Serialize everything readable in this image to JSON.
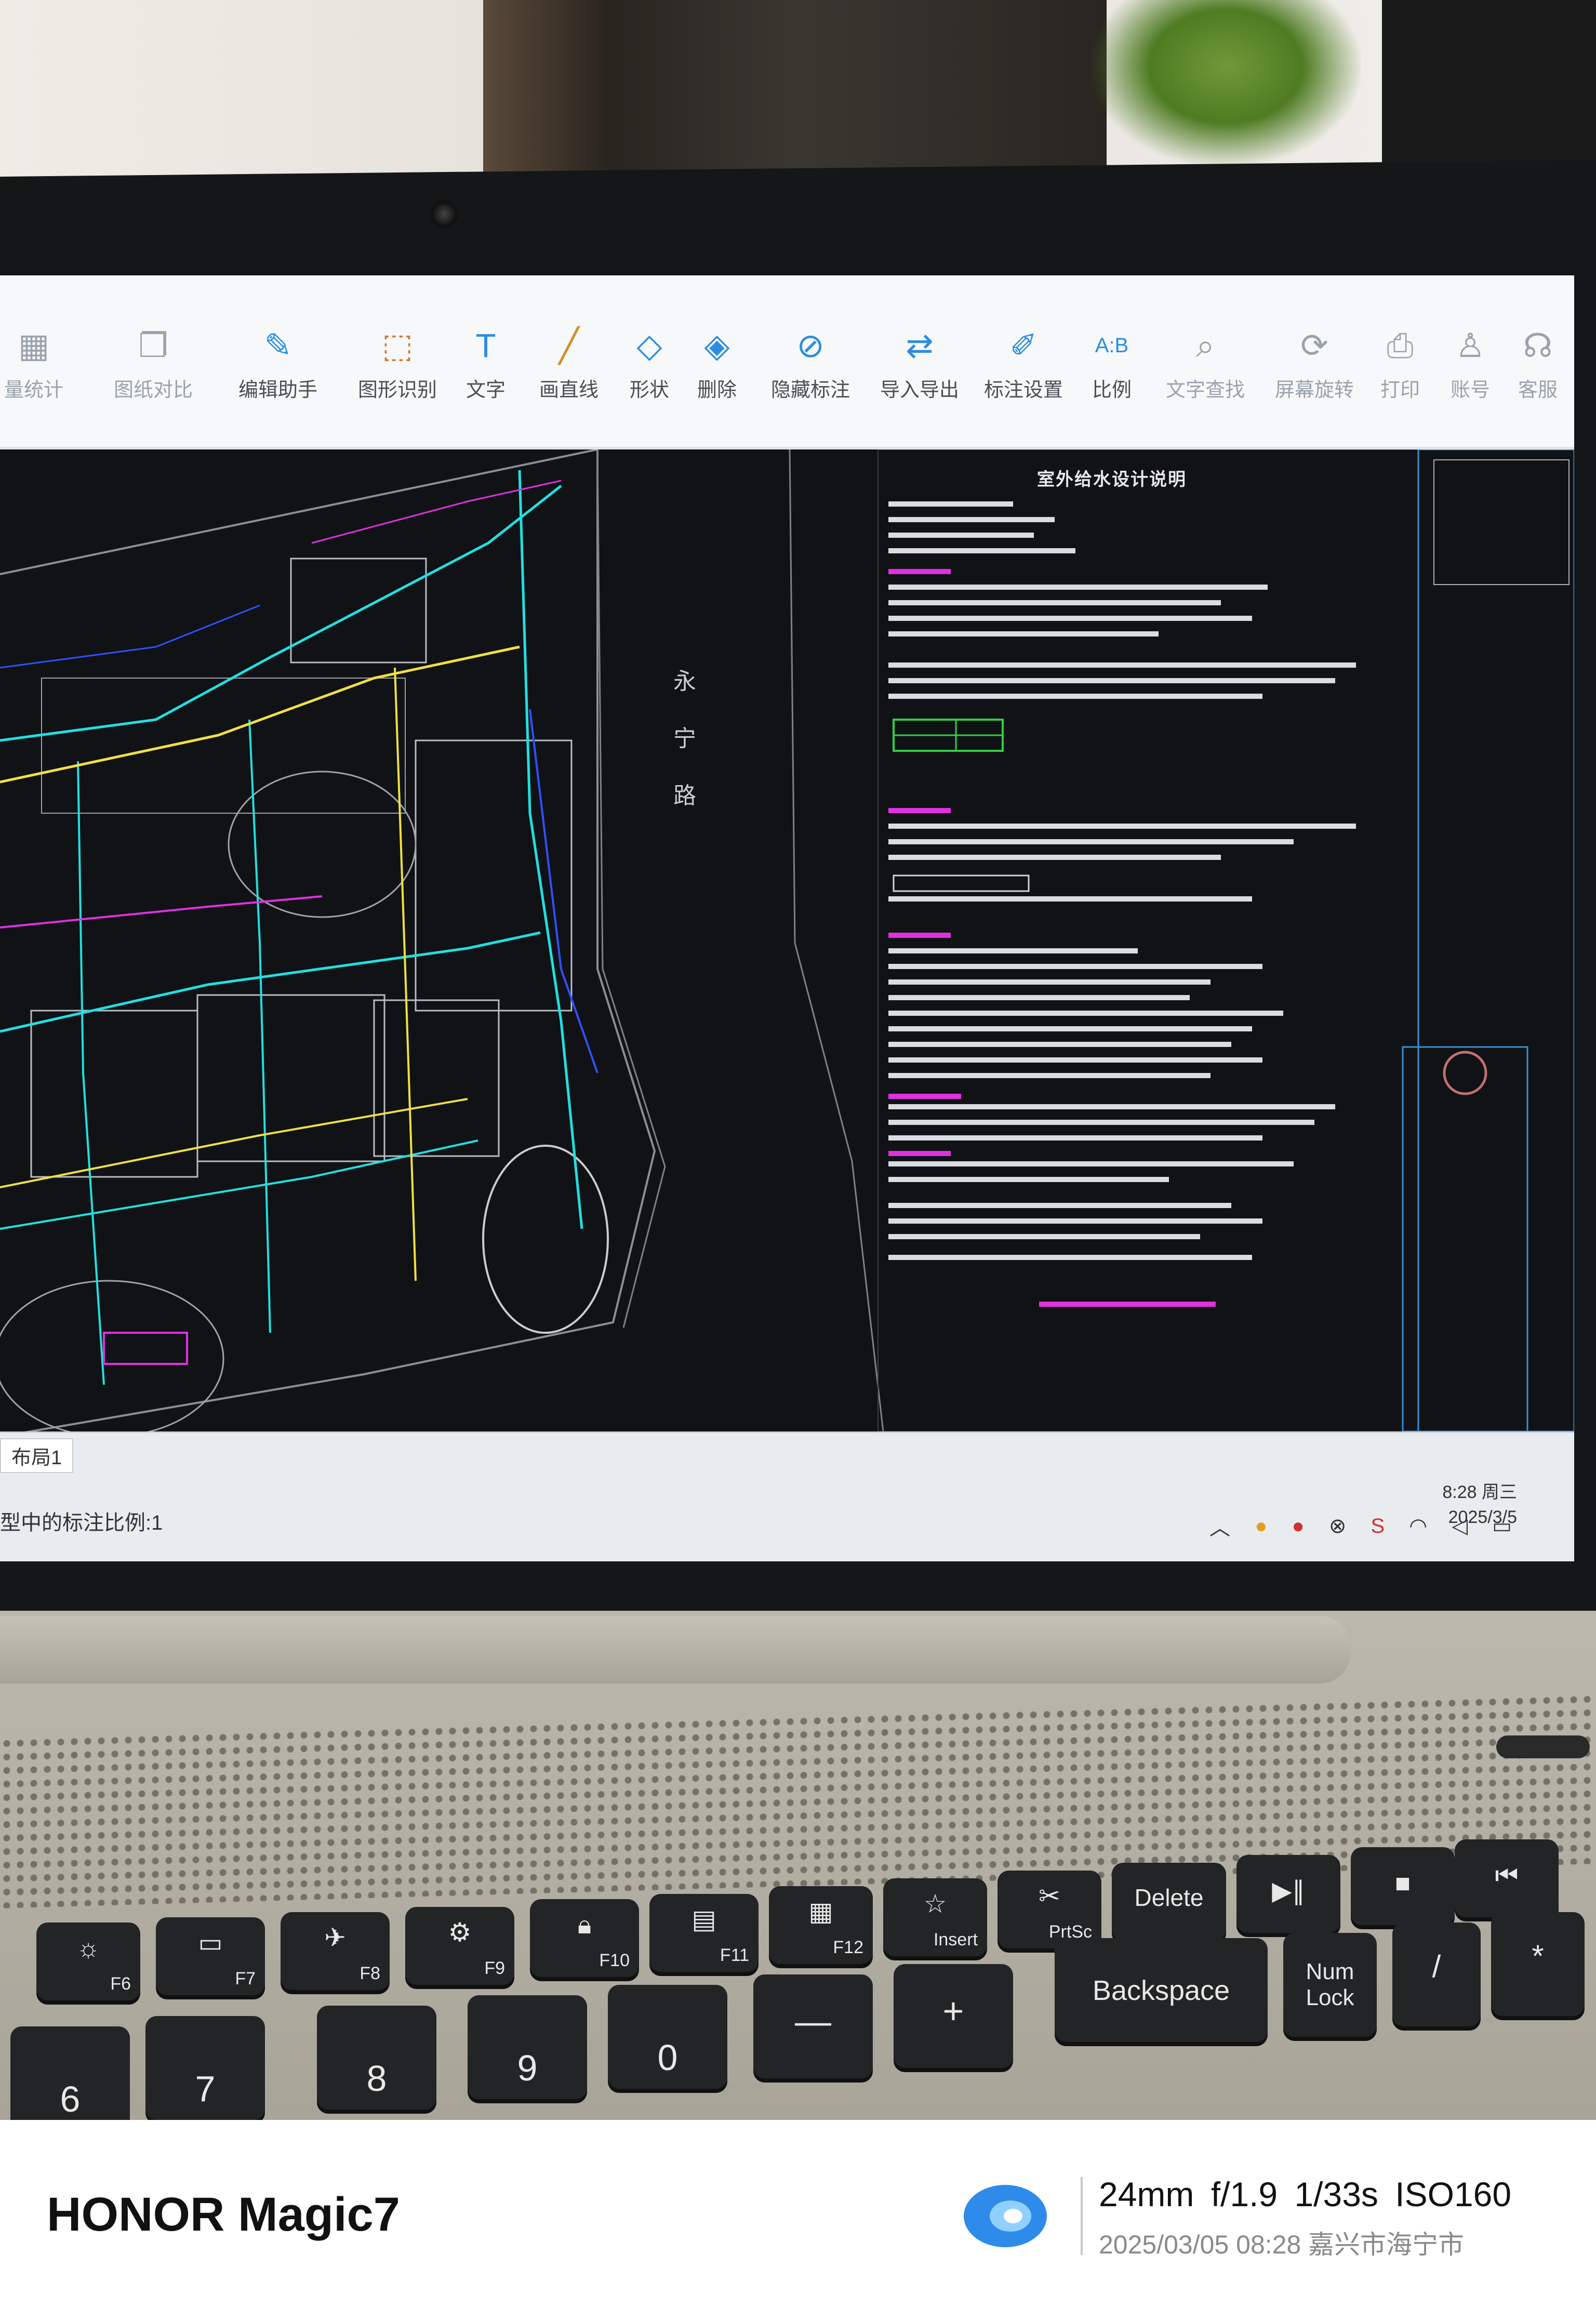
{
  "toolbar": {
    "items": [
      {
        "label": "量统计",
        "icon": "chart-icon"
      },
      {
        "label": "图纸对比",
        "icon": "compare-icon"
      },
      {
        "label": "编辑助手",
        "icon": "edit-helper-icon"
      },
      {
        "label": "图形识别",
        "icon": "shape-recognize-icon"
      },
      {
        "label": "文字",
        "icon": "text-icon"
      },
      {
        "label": "画直线",
        "icon": "line-icon"
      },
      {
        "label": "形状",
        "icon": "shape-icon"
      },
      {
        "label": "删除",
        "icon": "eraser-icon"
      },
      {
        "label": "隐藏标注",
        "icon": "hide-icon"
      },
      {
        "label": "导入导出",
        "icon": "import-export-icon"
      },
      {
        "label": "标注设置",
        "icon": "annotation-settings-icon"
      },
      {
        "label": "比例",
        "icon": "scale-icon"
      },
      {
        "label": "文字查找",
        "icon": "text-search-icon"
      },
      {
        "label": "屏幕旋转",
        "icon": "rotate-screen-icon"
      },
      {
        "label": "打印",
        "icon": "print-icon"
      },
      {
        "label": "账号",
        "icon": "account-icon"
      },
      {
        "label": "客服",
        "icon": "support-icon"
      }
    ]
  },
  "drawing": {
    "road_chars": [
      "永",
      "宁",
      "路"
    ],
    "notes_title": "室外给水设计说明"
  },
  "statusbar": {
    "tab": "布局1",
    "status_text": "型中的标注比例:1",
    "clock_time": "8:28 周三",
    "clock_date": "2025/3/5"
  },
  "keyboard": {
    "fn_keys": [
      "F6",
      "F7",
      "F8",
      "F9",
      "F10",
      "F11",
      "F12",
      "Insert",
      "PrtSc",
      "Delete"
    ],
    "main_keys": [
      "Backspace",
      "Num Lock"
    ],
    "number_keys": [
      "6",
      "7",
      "8",
      "9",
      "0"
    ]
  },
  "watermark": {
    "brand": "HONOR Magic7",
    "specs": "24mm  f/1.9  1/33s  ISO160",
    "meta": "2025/03/05 08:28 嘉兴市海宁市"
  },
  "colors": {
    "toolbar_icon": "#2c8ee0",
    "canvas_bg": "#101216",
    "cad_cyan": "#20e0e0",
    "cad_yellow": "#f0e040",
    "cad_magenta": "#e030e0"
  }
}
